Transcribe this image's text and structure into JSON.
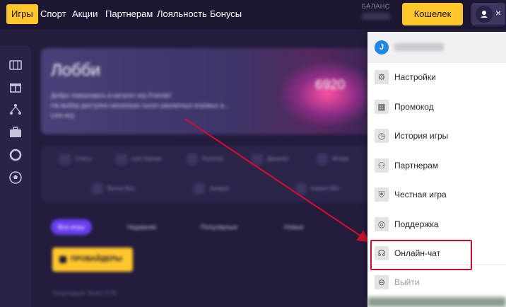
{
  "nav": {
    "items": [
      {
        "label": "Игры",
        "active": true
      },
      {
        "label": "Спорт",
        "active": false
      },
      {
        "label": "Акции",
        "active": false
      },
      {
        "label": "Партнерам",
        "active": false
      },
      {
        "label": "Лояльность",
        "active": false
      },
      {
        "label": "Бонусы",
        "active": false
      }
    ],
    "balance_label": "БАЛАНС",
    "wallet_label": "Кошелек",
    "close_icon": "×"
  },
  "sidebar": {
    "icons": [
      "slot-machine-icon",
      "gift-icon",
      "partners-icon",
      "briefcase-icon",
      "lifebuoy-icon",
      "soccer-ball-icon"
    ]
  },
  "lobby": {
    "title": "Лобби",
    "text_line1": "Добро пожаловать в каталог игр Friends!",
    "text_line2": "На выбор доступно несколько тысяч различных игровых а...",
    "text_line3": "Live-игр.",
    "hero_number": "6920",
    "filters_row1": [
      "Слоты",
      "Live Games",
      "Рулетка",
      "Джекпот",
      "Мгнов"
    ],
    "filters_row2": [
      "Bonus Buy",
      "Jackpot",
      "Instant Win"
    ],
    "categories": [
      "Все игры",
      "Недавние",
      "Популярные",
      "Новые"
    ],
    "providers_label": "ПРОВАЙДЕРЫ",
    "games_count": "Популярные: Всего 2731"
  },
  "menu": {
    "user_initial": "J",
    "items": [
      {
        "label": "Настройки",
        "icon": "gear-icon",
        "glyph": "⚙"
      },
      {
        "label": "Промокод",
        "icon": "promo-gift-icon",
        "glyph": "▦"
      },
      {
        "label": "История игры",
        "icon": "clock-icon",
        "glyph": "◷"
      },
      {
        "label": "Партнерам",
        "icon": "partners-icon",
        "glyph": "⚇"
      },
      {
        "label": "Честная игра",
        "icon": "shield-icon",
        "glyph": "⛨"
      },
      {
        "label": "Поддержка",
        "icon": "lifebuoy-icon",
        "glyph": "◎"
      },
      {
        "label": "Онлайн-чат",
        "icon": "headset-icon",
        "glyph": "☊"
      },
      {
        "label": "Выйти",
        "icon": "logout-icon",
        "glyph": "⊖"
      }
    ]
  },
  "colors": {
    "accent": "#ffc72c",
    "background": "#231c3d",
    "annotation": "#c8102e"
  }
}
